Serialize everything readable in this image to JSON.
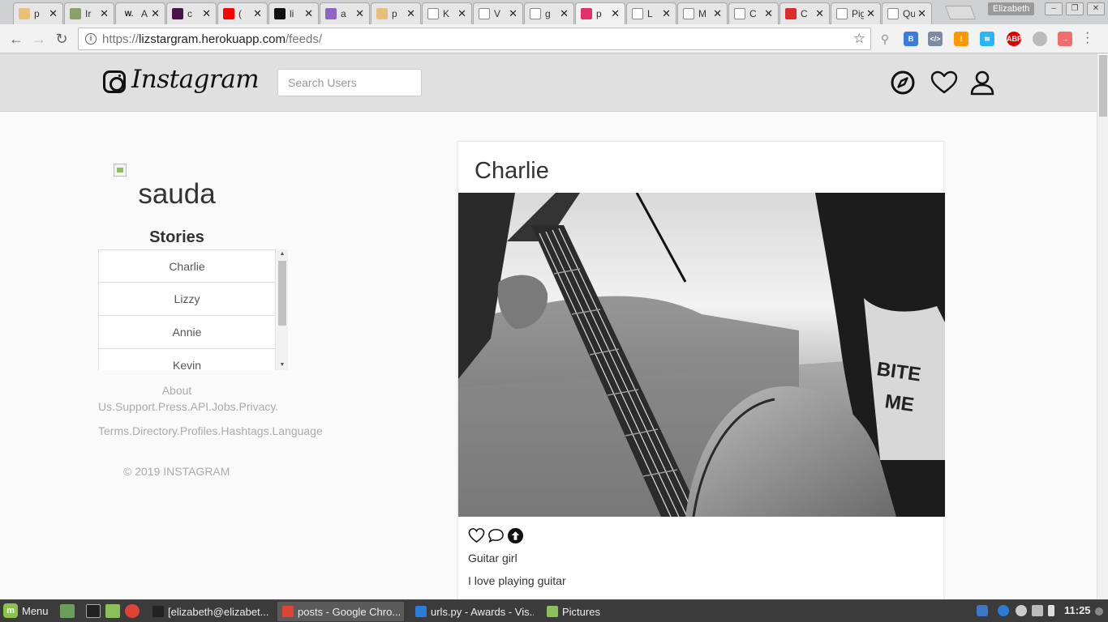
{
  "browser": {
    "tabs": [
      {
        "label": "p",
        "color": "#e8c07a"
      },
      {
        "label": "Ir",
        "color": "#8aa16b"
      },
      {
        "label": "A",
        "color": "#222222",
        "glyph": "W."
      },
      {
        "label": "c",
        "color": "#4a154b"
      },
      {
        "label": "(",
        "color": "#ff0000"
      },
      {
        "label": "li",
        "color": "#111111"
      },
      {
        "label": "a",
        "color": "#8e64c4"
      },
      {
        "label": "p",
        "color": "#e8c07a"
      },
      {
        "label": "K",
        "color": "#ffffff"
      },
      {
        "label": "V",
        "color": "#ffffff"
      },
      {
        "label": "g",
        "color": "#ffffff"
      },
      {
        "label": "p",
        "color": "#e1306c"
      },
      {
        "label": "L",
        "color": "#ffffff"
      },
      {
        "label": "M",
        "color": "#ffffff"
      },
      {
        "label": "C",
        "color": "#ffffff"
      },
      {
        "label": "C",
        "color": "#dd2c2c"
      },
      {
        "label": "Pig D",
        "color": "#ffffff"
      },
      {
        "label": "Quiz",
        "color": "#ffffff"
      }
    ],
    "active_tab_index": 11,
    "profile_name": "Elizabeth",
    "url_scheme": "https://",
    "url_host": "lizstargram.herokuapp.com",
    "url_path": "/feeds/"
  },
  "app": {
    "logo_text": "Instagram",
    "search_placeholder": "Search Users"
  },
  "sidebar": {
    "username": "sauda",
    "stories_heading": "Stories",
    "stories": [
      "Charlie",
      "Lizzy",
      "Annie",
      "Kevin"
    ],
    "footer_line1": "About",
    "footer_line2": "Us.Support.Press.API.Jobs.Privacy.",
    "footer_line3": "Terms.Directory.Profiles.Hashtags.Language",
    "copyright": "© 2019 INSTAGRAM"
  },
  "post": {
    "username": "Charlie",
    "image_alt": "Guitar girl",
    "title": "Guitar girl",
    "caption": "I love playing guitar"
  },
  "taskbar": {
    "menu_label": "Menu",
    "windows": [
      {
        "label": "[elizabeth@elizabet...",
        "active": false
      },
      {
        "label": "posts - Google Chro...",
        "active": true
      },
      {
        "label": "urls.py - Awards - Vis...",
        "active": false
      },
      {
        "label": "Pictures",
        "active": false
      }
    ],
    "clock": "11:25"
  }
}
